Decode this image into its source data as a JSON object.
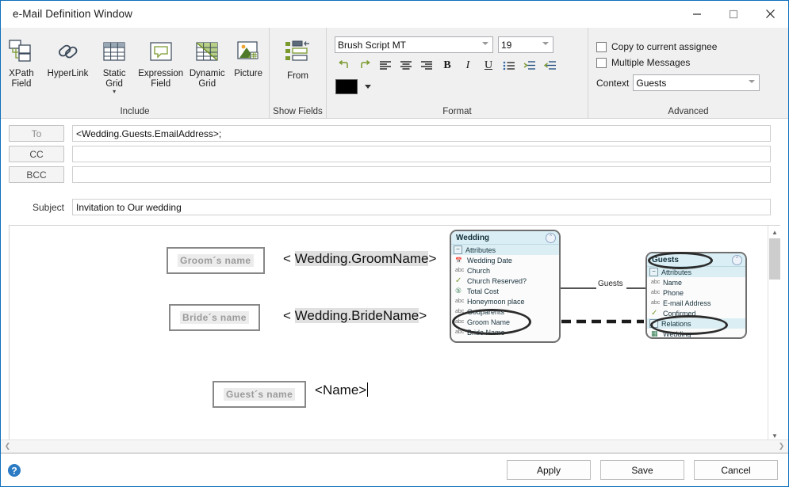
{
  "window": {
    "title": "e-Mail Definition Window",
    "controls": {
      "minimize": "minimize-icon",
      "maximize": "maximize-icon",
      "close": "close-icon"
    }
  },
  "ribbon": {
    "groups": [
      {
        "label": "Include",
        "buttons": [
          {
            "label_line1": "XPath",
            "label_line2": "Field",
            "icon": "xpath-field-icon"
          },
          {
            "label_line1": "HyperLink",
            "label_line2": "",
            "icon": "hyperlink-icon"
          },
          {
            "label_line1": "Static",
            "label_line2": "Grid",
            "icon": "static-grid-icon",
            "has_dropdown": true
          },
          {
            "label_line1": "Expression",
            "label_line2": "Field",
            "icon": "expression-field-icon"
          },
          {
            "label_line1": "Dynamic",
            "label_line2": "Grid",
            "icon": "dynamic-grid-icon"
          },
          {
            "label_line1": "Picture",
            "label_line2": "",
            "icon": "picture-icon"
          }
        ]
      },
      {
        "label": "Show Fields",
        "from_button": {
          "label": "From",
          "icon": "from-fields-icon"
        }
      },
      {
        "label": "Format",
        "font_name": "Brush Script MT",
        "font_size": "19",
        "tools": [
          {
            "name": "undo-icon",
            "glyph": "↰"
          },
          {
            "name": "redo-icon",
            "glyph": "↱"
          },
          {
            "name": "align-left-icon",
            "glyph": "≡"
          },
          {
            "name": "align-center-icon",
            "glyph": "≡"
          },
          {
            "name": "align-right-icon",
            "glyph": "≡"
          },
          {
            "name": "bold-icon",
            "glyph": "B"
          },
          {
            "name": "italic-icon",
            "glyph": "I"
          },
          {
            "name": "underline-icon",
            "glyph": "U"
          },
          {
            "name": "bullet-list-icon",
            "glyph": "⁞≡"
          },
          {
            "name": "indent-increase-icon",
            "glyph": "→≡"
          },
          {
            "name": "indent-decrease-icon",
            "glyph": "←≡"
          }
        ],
        "text_color": "#000000"
      },
      {
        "label": "Advanced",
        "copy_to_assignee": {
          "label": "Copy to current assignee",
          "checked": false
        },
        "multiple_messages": {
          "label": "Multiple Messages",
          "checked": false
        },
        "context": {
          "label": "Context",
          "value": "Guests"
        }
      }
    ]
  },
  "headers": {
    "to": {
      "button": "To",
      "value": "<Wedding.Guests.EmailAddress>;"
    },
    "cc": {
      "button": "CC",
      "value": ""
    },
    "bcc": {
      "button": "BCC",
      "value": ""
    },
    "subject": {
      "label": "Subject",
      "value": "Invitation to Our wedding"
    }
  },
  "body": {
    "fields": [
      {
        "chip": "Groom´s name",
        "expression_prefix": "< ",
        "expression_highlight": "Wedding.GroomName",
        "expression_suffix": ">"
      },
      {
        "chip": "Bride´s name",
        "expression_prefix": "< ",
        "expression_highlight": "Wedding.BrideName",
        "expression_suffix": ">"
      },
      {
        "chip": "Guest´s name",
        "expression_prefix": "<",
        "expression_highlight": "Name",
        "expression_suffix": ">"
      }
    ],
    "diagram": {
      "relation_label": "Guests",
      "multiplicity": "*",
      "entities": [
        {
          "name": "Wedding",
          "section": "Attributes",
          "attributes": [
            {
              "icon": "date-icon",
              "name": "Wedding Date"
            },
            {
              "icon": "abc-icon",
              "name": "Church"
            },
            {
              "icon": "check-icon",
              "name": "Church Reserved?"
            },
            {
              "icon": "money-icon",
              "name": "Total Cost"
            },
            {
              "icon": "abc-icon",
              "name": "Honeymoon place"
            },
            {
              "icon": "abc-icon",
              "name": "Godparents"
            },
            {
              "icon": "abc-icon",
              "name": "Groom Name"
            },
            {
              "icon": "abc-icon",
              "name": "Bride Name"
            }
          ]
        },
        {
          "name": "Guests",
          "section": "Attributes",
          "attributes": [
            {
              "icon": "abc-icon",
              "name": "Name"
            },
            {
              "icon": "abc-icon",
              "name": "Phone"
            },
            {
              "icon": "abc-icon",
              "name": "E-mail Address"
            },
            {
              "icon": "check-icon",
              "name": "Confirmed"
            }
          ],
          "section2": "Relations",
          "relations": [
            {
              "icon": "relation-icon",
              "name": "Wedding"
            }
          ]
        }
      ]
    }
  },
  "footer": {
    "help": "help-icon",
    "apply": "Apply",
    "save": "Save",
    "cancel": "Cancel"
  }
}
